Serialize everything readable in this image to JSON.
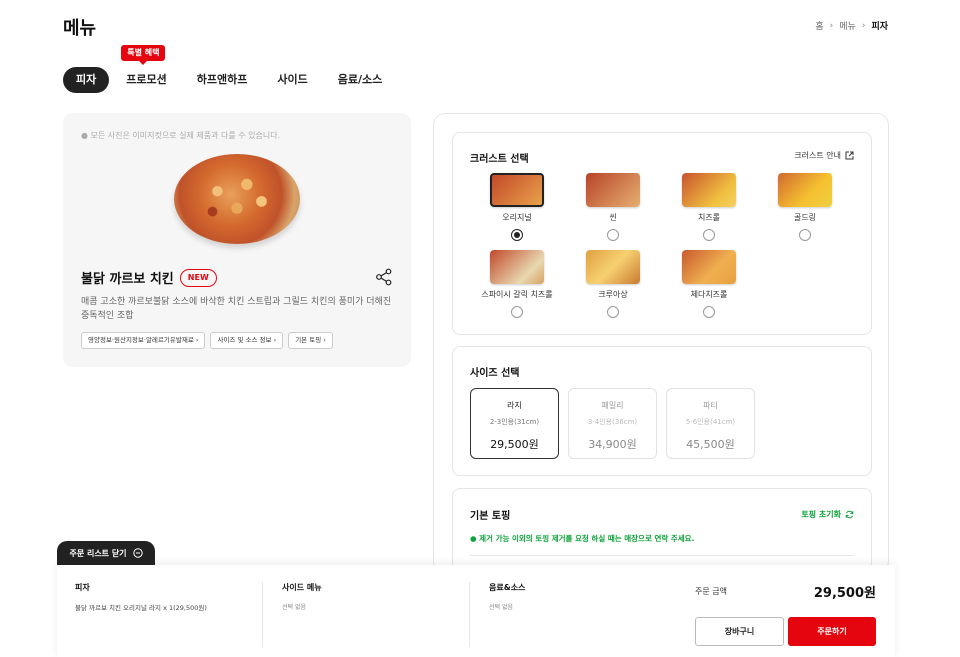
{
  "page": {
    "title": "메뉴"
  },
  "breadcrumb": {
    "items": [
      "홈",
      "메뉴"
    ],
    "current": "피자"
  },
  "tabs": [
    {
      "label": "피자",
      "active": true
    },
    {
      "label": "프로모션",
      "badge": "특별 혜택"
    },
    {
      "label": "하프앤하프"
    },
    {
      "label": "사이드"
    },
    {
      "label": "음료/소스"
    }
  ],
  "product": {
    "photo_note": "● 모든 사진은 이미지컷으로 실제 제품과 다를 수 있습니다.",
    "name": "불닭 까르보 치킨",
    "badge": "NEW",
    "description": "매콤 고소한 까르보불닭 소스에 바삭한 치킨 스트립과 그릴드 치킨의 풍미가 더해진 중독적인 조합",
    "info_buttons": [
      "영양정보·원산지정보·알레르기유발재료 ›",
      "사이즈 및 소스 정보 ›",
      "기본 토핑 ›"
    ]
  },
  "crust": {
    "title": "크러스트 선택",
    "guide": "크러스트 안내",
    "options": [
      {
        "label": "오리지널",
        "selected": true
      },
      {
        "label": "씬",
        "selected": false
      },
      {
        "label": "치즈롤",
        "selected": false
      },
      {
        "label": "골드링",
        "selected": false
      },
      {
        "label": "스파이시 갈릭 치즈롤",
        "selected": false
      },
      {
        "label": "크루아상",
        "selected": false
      },
      {
        "label": "체다치즈롤",
        "selected": false
      }
    ]
  },
  "size": {
    "title": "사이즈 선택",
    "options": [
      {
        "name": "라지",
        "serving": "2-3인용(31cm)",
        "price": "29,500원",
        "selected": true
      },
      {
        "name": "패밀리",
        "serving": "3-4인용(36cm)",
        "price": "34,900원",
        "selected": false
      },
      {
        "name": "파티",
        "serving": "5-6인용(41cm)",
        "price": "45,500원",
        "selected": false
      }
    ]
  },
  "topping": {
    "title": "기본 토핑",
    "reset": "토핑 초기화",
    "note": "● 제거 가능 이외의 토핑 제거를 요청 하실 때는 매장으로 연락 주세요."
  },
  "order": {
    "toggle_label": "주문 리스트 닫기",
    "pizza_title": "피자",
    "pizza_item": "불닭 까르보 치킨 오리지널 라지 x 1(29,500원)",
    "side_title": "사이드 메뉴",
    "side_empty": "선택 없음",
    "drink_title": "음료&소스",
    "drink_empty": "선택 없음",
    "amount_label": "주문 금액",
    "amount_value": "29,500원",
    "cart_label": "장바구니",
    "order_label": "주문하기"
  },
  "colors": {
    "accent": "#e4050f",
    "green": "#0ea33a",
    "dark": "#222222"
  }
}
